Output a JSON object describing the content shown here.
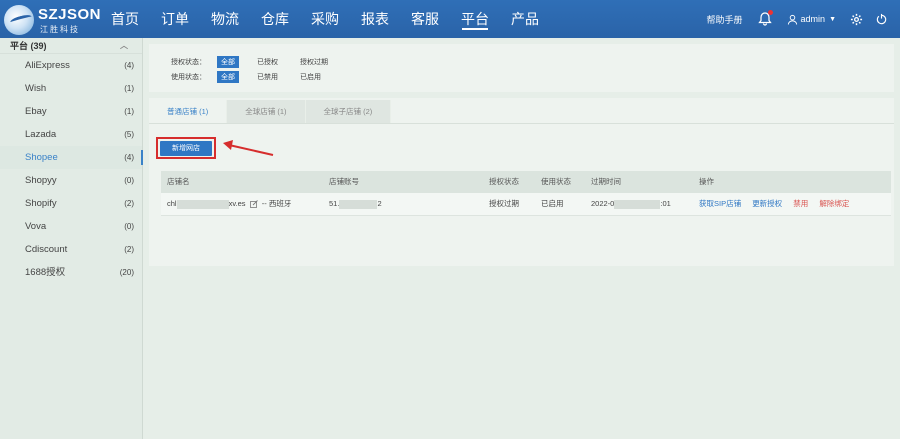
{
  "brand": {
    "name": "SZJSON",
    "sub": "江胜科技"
  },
  "nav": [
    "首页",
    "订单",
    "物流",
    "仓库",
    "采购",
    "报表",
    "客服",
    "平台",
    "产品"
  ],
  "nav_active": "平台",
  "topbar": {
    "help": "帮助手册",
    "user": "admin"
  },
  "sidebar": {
    "header": "平台 (39)",
    "items": [
      {
        "label": "AliExpress",
        "count": "(4)"
      },
      {
        "label": "Wish",
        "count": "(1)"
      },
      {
        "label": "Ebay",
        "count": "(1)"
      },
      {
        "label": "Lazada",
        "count": "(5)"
      },
      {
        "label": "Shopee",
        "count": "(4)"
      },
      {
        "label": "Shopyy",
        "count": "(0)"
      },
      {
        "label": "Shopify",
        "count": "(2)"
      },
      {
        "label": "Vova",
        "count": "(0)"
      },
      {
        "label": "Cdiscount",
        "count": "(2)"
      },
      {
        "label": "1688授权",
        "count": "(20)"
      }
    ],
    "active": "Shopee"
  },
  "filters": {
    "auth": {
      "label": "授权状态：",
      "options": [
        "全部",
        "已授权",
        "授权过期"
      ],
      "selected": "全部"
    },
    "use": {
      "label": "使用状态：",
      "options": [
        "全部",
        "已禁用",
        "已启用"
      ],
      "selected": "全部"
    }
  },
  "tabs": [
    {
      "label": "普通店铺 (1)",
      "active": true
    },
    {
      "label": "全球店铺 (1)",
      "active": false
    },
    {
      "label": "全球子店铺 (2)",
      "active": false
    }
  ],
  "new_shop_button": "新增网店",
  "table": {
    "headers": [
      "店铺名",
      "店铺账号",
      "授权状态",
      "使用状态",
      "过期时间",
      "操作"
    ],
    "rows": [
      {
        "name_prefix": "chl",
        "name_suffix": "xv.es",
        "region": "-- 西班牙",
        "account_prefix": "51.",
        "account_suffix": "2",
        "auth_status": "授权过期",
        "use_status": "已启用",
        "expire_prefix": "2022-0",
        "expire_suffix": ":01",
        "actions": [
          "获取SIP店铺",
          "更新授权",
          "禁用",
          "解除绑定"
        ]
      }
    ]
  },
  "colors": {
    "topbar": "#2a63a8",
    "accent": "#2f77c4",
    "danger": "#d62d2d"
  }
}
